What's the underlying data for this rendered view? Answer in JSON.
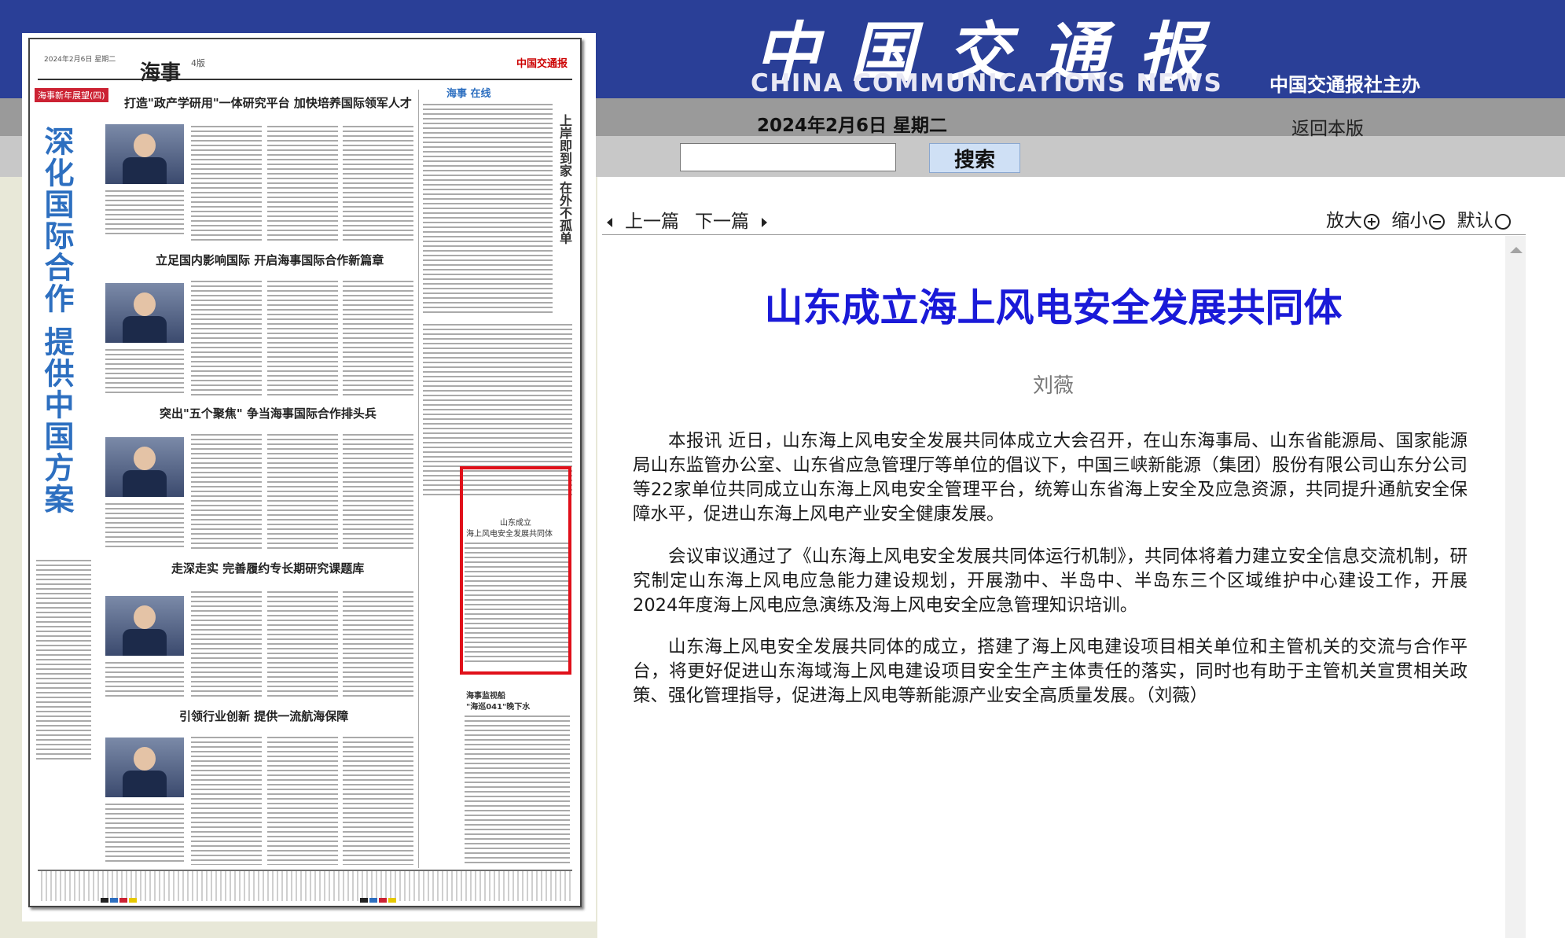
{
  "header": {
    "logo_cn": "中国交通报",
    "logo_en": "CHINA COMMUNICATIONS NEWS",
    "publisher": "中国交通报社主办",
    "date": "2024年2月6日 星期二",
    "back_link": "返回本版",
    "search": {
      "placeholder": "",
      "value": "",
      "button_label": "搜索"
    }
  },
  "newspaper_page": {
    "section": "海事",
    "page_no": "4版",
    "masthead_small": "2024年2月6日 星期二",
    "logo_mini": "中国交通报",
    "tag": "海事新年展望(四)",
    "vertical_title": "深化国际合作 提供中国方案",
    "right_column_title": "上岸即到家 在外不孤单",
    "right_column_header": "海事 在线",
    "headlines": [
      "打造\"政产学研用\"一体研究平台 加快培养国际领军人才",
      "立足国内影响国际 开启海事国际合作新篇章",
      "突出\"五个聚焦\" 争当海事国际合作排头兵",
      "走深走实 完善履约专长期研究课题库",
      "引领行业创新 提供一流航海保障"
    ],
    "highlighted_article_title_1": "山东成立",
    "highlighted_article_title_2": "海上风电安全发展共同体",
    "below_highlight_title_1": "海事监视船",
    "below_highlight_title_2": "\"海巡041\"晚下水"
  },
  "article_nav": {
    "prev": "上一篇",
    "next": "下一篇",
    "zoom_in": "放大",
    "zoom_out": "缩小",
    "default": "默认"
  },
  "article": {
    "title": "山东成立海上风电安全发展共同体",
    "author": "刘薇",
    "paragraphs": [
      "本报讯 近日，山东海上风电安全发展共同体成立大会召开，在山东海事局、山东省能源局、国家能源局山东监管办公室、山东省应急管理厅等单位的倡议下，中国三峡新能源（集团）股份有限公司山东分公司等22家单位共同成立山东海上风电安全管理平台，统筹山东省海上安全及应急资源，共同提升通航安全保障水平，促进山东海上风电产业安全健康发展。",
      "会议审议通过了《山东海上风电安全发展共同体运行机制》，共同体将着力建立安全信息交流机制，研究制定山东海上风电应急能力建设规划，开展渤中、半岛中、半岛东三个区域维护中心建设工作，开展2024年度海上风电应急演练及海上风电安全应急管理知识培训。",
      "山东海上风电安全发展共同体的成立，搭建了海上风电建设项目相关单位和主管机关的交流与合作平台，将更好促进山东海域海上风电建设项目安全生产主体责任的落实，同时也有助于主管机关宣贯相关政策、强化管理指导，促进海上风电等新能源产业安全高质量发展。（刘薇）"
    ]
  },
  "colors": {
    "header_blue": "#2a3f97",
    "title_blue": "#1a1ad8",
    "highlight_red": "#e0101a",
    "vertical_title_blue": "#2d6fc0"
  }
}
